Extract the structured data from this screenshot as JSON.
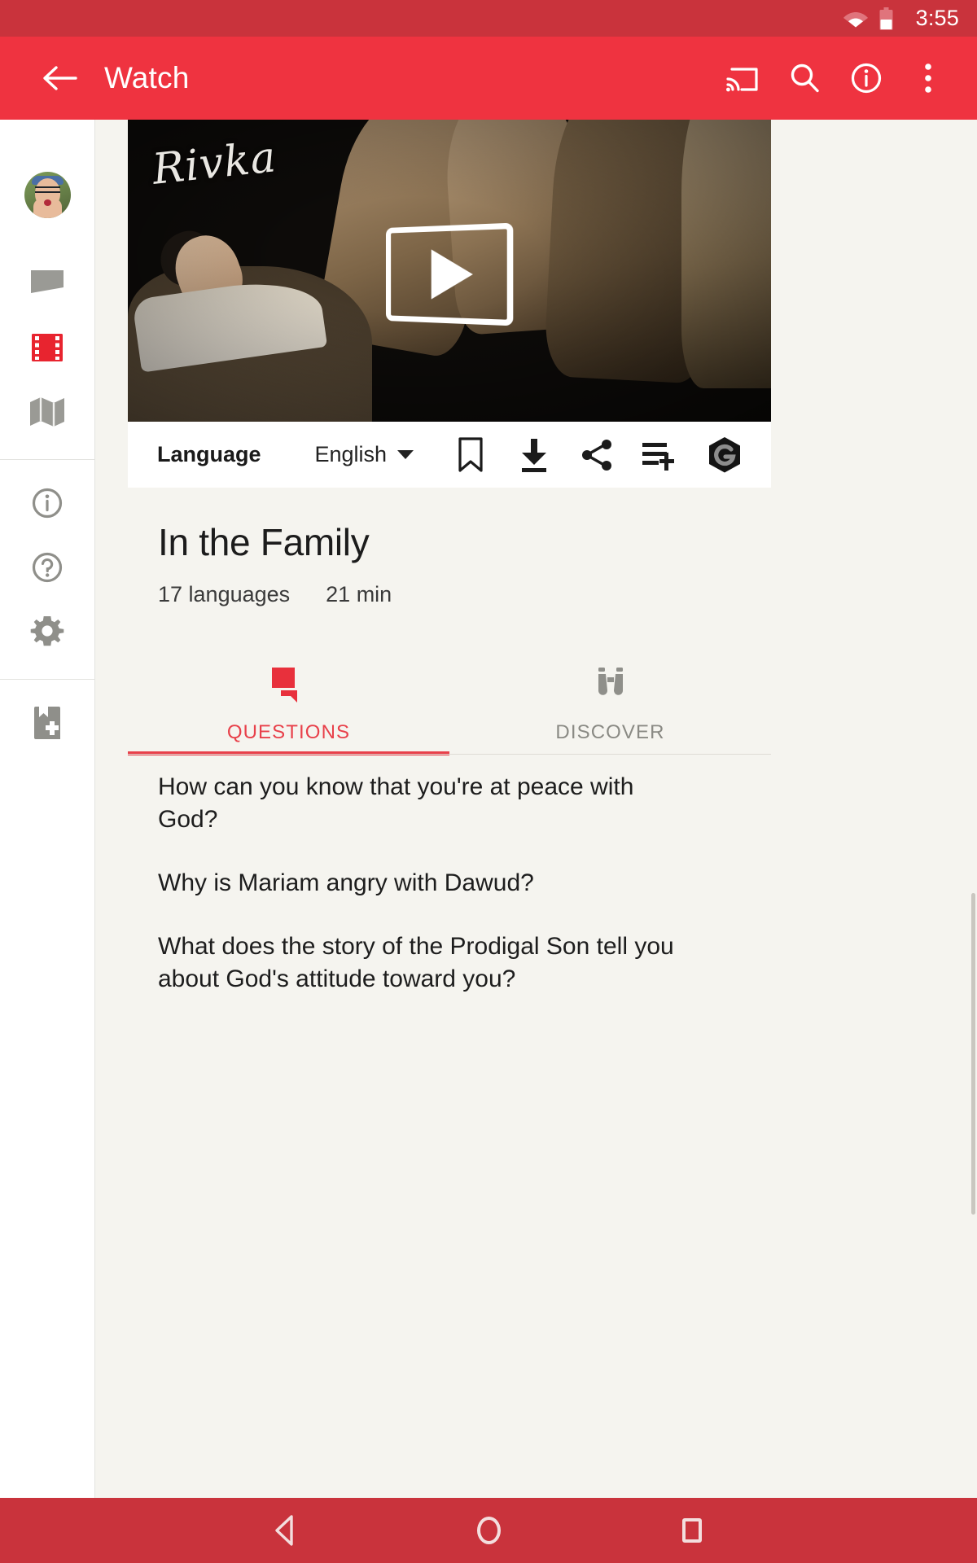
{
  "status_bar": {
    "time": "3:55",
    "wifi_icon": "wifi-icon",
    "battery_icon": "battery-icon"
  },
  "app_bar": {
    "back_icon": "back-arrow-icon",
    "title": "Watch",
    "actions": [
      {
        "name": "cast-icon",
        "label": "Cast"
      },
      {
        "name": "search-icon",
        "label": "Search"
      },
      {
        "name": "info-icon",
        "label": "Info"
      },
      {
        "name": "overflow-menu-icon",
        "label": "More options"
      }
    ]
  },
  "sidebar": {
    "items": [
      {
        "name": "avatar",
        "label": "Profile",
        "active": false
      },
      {
        "name": "chat-bubble-icon",
        "label": "Conversations",
        "active": false
      },
      {
        "name": "film-strip-icon",
        "label": "Videos",
        "active": true
      },
      {
        "name": "map-icon",
        "label": "Map",
        "active": false
      },
      {
        "name": "info-circle-icon",
        "label": "About",
        "active": false
      },
      {
        "name": "help-circle-icon",
        "label": "Help",
        "active": false
      },
      {
        "name": "gear-icon",
        "label": "Settings",
        "active": false
      },
      {
        "name": "bible-bookmark-icon",
        "label": "Scripture",
        "active": false
      }
    ]
  },
  "video": {
    "overlay_title": "Rivka",
    "play_button": "play-button-icon"
  },
  "action_bar": {
    "language_label": "Language",
    "language_value": "English",
    "dropdown_icon": "chevron-down-icon",
    "icons": [
      {
        "name": "bookmark-icon",
        "label": "Bookmark"
      },
      {
        "name": "download-icon",
        "label": "Download"
      },
      {
        "name": "share-icon",
        "label": "Share"
      },
      {
        "name": "playlist-add-icon",
        "label": "Add to playlist"
      },
      {
        "name": "app-logo-icon",
        "label": "App"
      }
    ]
  },
  "details": {
    "title": "In the Family",
    "languages": "17 languages",
    "duration": "21 min"
  },
  "tabs": [
    {
      "label": "QUESTIONS",
      "icon": "question-chat-icon",
      "active": true
    },
    {
      "label": "DISCOVER",
      "icon": "binoculars-icon",
      "active": false
    }
  ],
  "questions": [
    "How can you know that you're at peace with God?",
    "Why is Mariam angry with Dawud?",
    "What does the story of the Prodigal Son tell you about God's attitude toward you?"
  ],
  "nav_bar": {
    "back": "nav-back-icon",
    "home": "nav-home-icon",
    "recents": "nav-recents-icon"
  },
  "colors": {
    "accent": "#ef3340",
    "status_bar": "#c9333c",
    "background": "#f5f4ef",
    "tab_active": "#e8404a"
  }
}
